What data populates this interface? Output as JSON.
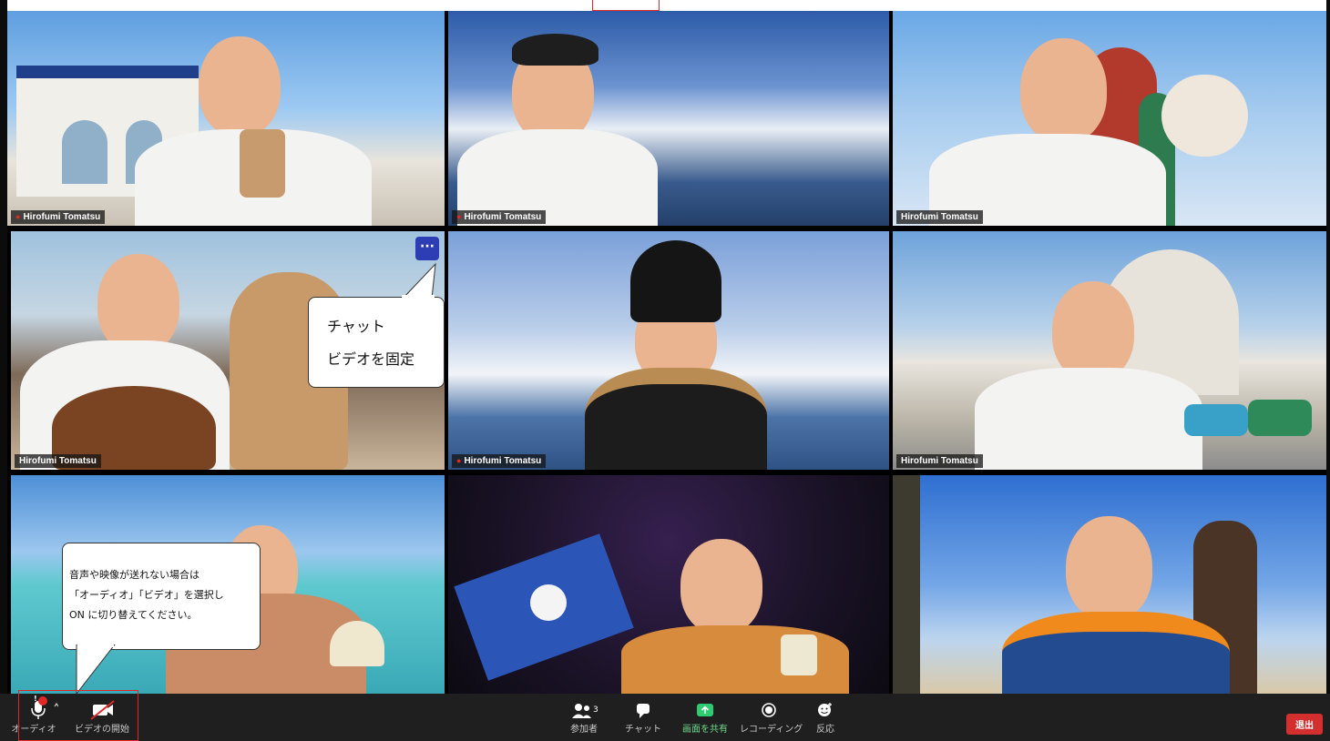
{
  "tiles": [
    {
      "name": "Hirofumi Tomatsu",
      "muted": true
    },
    {
      "name": "Hirofumi Tomatsu",
      "muted": true
    },
    {
      "name": "Hirofumi Tomatsu",
      "muted": false
    },
    {
      "name": "Hirofumi Tomatsu",
      "muted": false,
      "active": true
    },
    {
      "name": "Hirofumi Tomatsu",
      "muted": true
    },
    {
      "name": "Hirofumi Tomatsu",
      "muted": false
    },
    {
      "name": "",
      "muted": false
    },
    {
      "name": "",
      "muted": false
    },
    {
      "name": "",
      "muted": false
    }
  ],
  "more_button": "···",
  "context_menu": {
    "items": [
      "チャット",
      "ビデオを固定"
    ]
  },
  "help_callout": {
    "lines": [
      "音声や映像が送れない場合は",
      "「オーディオ」「ビデオ」を選択し",
      "ON に切り替えてください。"
    ]
  },
  "toolbar": {
    "audio_label": "オーディオ",
    "audio_badge": "!",
    "video_label": "ビデオの開始",
    "participants_label": "参加者",
    "participants_count": "3",
    "chat_label": "チャット",
    "share_label": "画面を共有",
    "record_label": "レコーディング",
    "reactions_label": "反応",
    "leave_label": "退出"
  },
  "colors": {
    "toolbar_bg": "#1f1f1f",
    "share_green": "#2ecc71",
    "leave_red": "#d32f2f",
    "highlight_red": "#e02828",
    "more_button_blue": "#2d3eb5",
    "active_border": "#d8d98c"
  }
}
